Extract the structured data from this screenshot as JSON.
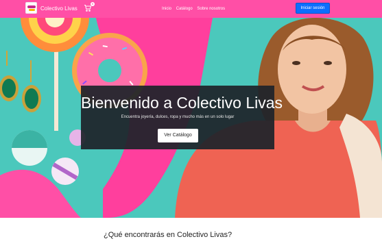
{
  "nav": {
    "brand": "Colectivo Livas",
    "cart_count": "0",
    "links": [
      "Inicio",
      "Catálogo",
      "Sobre nosotros"
    ],
    "login_label": "Iniciar sesión"
  },
  "hero": {
    "title": "Bienvenido a Colectivo Livas",
    "subtitle": "Encuentra joyería, dulces, ropa y mucho más en un solo lugar",
    "button_label": "Ver Catálogo"
  },
  "section": {
    "title": "¿Qué encontrarás en Colectivo Livas?"
  },
  "icons": [
    "logo-icon",
    "cart-icon"
  ],
  "colors": {
    "navbar": "#ff4fa6",
    "login_button": "#0d6efd",
    "hero_overlay": "#1e242a",
    "hero_bg": "#4bc8bc"
  }
}
